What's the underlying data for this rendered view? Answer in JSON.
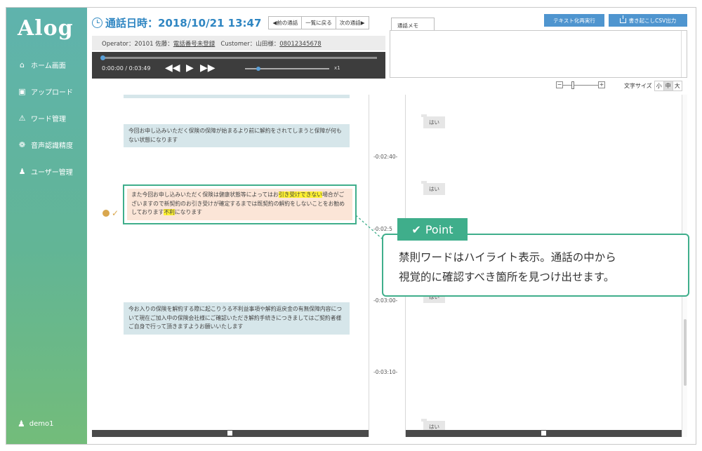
{
  "brand": "Alog",
  "sidebar": {
    "items": [
      {
        "icon": "home-icon",
        "label": "ホーム画面"
      },
      {
        "icon": "upload-icon",
        "label": "アップロード"
      },
      {
        "icon": "alert-icon",
        "label": "ワード管理"
      },
      {
        "icon": "accuracy-icon",
        "label": "音声認識精度"
      },
      {
        "icon": "users-icon",
        "label": "ユーザー管理"
      }
    ],
    "user": "demo1"
  },
  "header": {
    "title": "通話日時：2018/10/21 13:47",
    "prev_call": "◀前の通話",
    "back_to_list": "一覧に戻る",
    "next_call": "次の通話▶"
  },
  "call_info": {
    "operator_label": "Operator：20101 佐藤：",
    "operator_phone": "電話番号未登録",
    "customer_label": "Customer：山田様：",
    "customer_phone": "08012345678"
  },
  "player": {
    "time": "0:00:00 / 0:03:49",
    "speed": "x1",
    "progress": 0
  },
  "memo": {
    "tab": "通話メモ",
    "value": ""
  },
  "actions": {
    "retext": "テキスト化再実行",
    "export_csv": "書き起こしCSV出力"
  },
  "font_size": {
    "label": "文字サイズ",
    "options": [
      "小",
      "中",
      "大"
    ],
    "selected": "中"
  },
  "zoom": {
    "minus": "−",
    "plus": "+"
  },
  "transcript": {
    "operator_msgs": [
      "今回お申し込みいただく保険の保障が始まるより前に解約をされてしまうと保障が何もない状態になります",
      "今お入りの保険を解約する際に起こりうる不利益事項や解約返戻金の有無保障内容について現在ご加入中の保険会社様にご確認いただき解約手続きにつきましてはご契約者様ご自身で行って頂きますようお願いいたします"
    ],
    "highlight_msg": {
      "part1": "また今回お申し込みいただく保険は健康状態等によってはお",
      "kw1": "引き受けできない",
      "part2": "場合がございますので新契約のお引き受けが確定するまでは既契約の解約をしないことをお勧めしております",
      "kw2": "不利",
      "part3": "になります"
    },
    "timestamps": [
      "-0:02:40-",
      "-0:02:5",
      "-0:03:00-",
      "-0:03:10-"
    ],
    "customer_msgs": [
      "はい",
      "はい",
      "はい",
      "はい"
    ]
  },
  "point": {
    "tag": "Point",
    "line1": "禁則ワードはハイライト表示。通話の中から",
    "line2": "視覚的に確認すべき箇所を見つけ出せます。"
  }
}
